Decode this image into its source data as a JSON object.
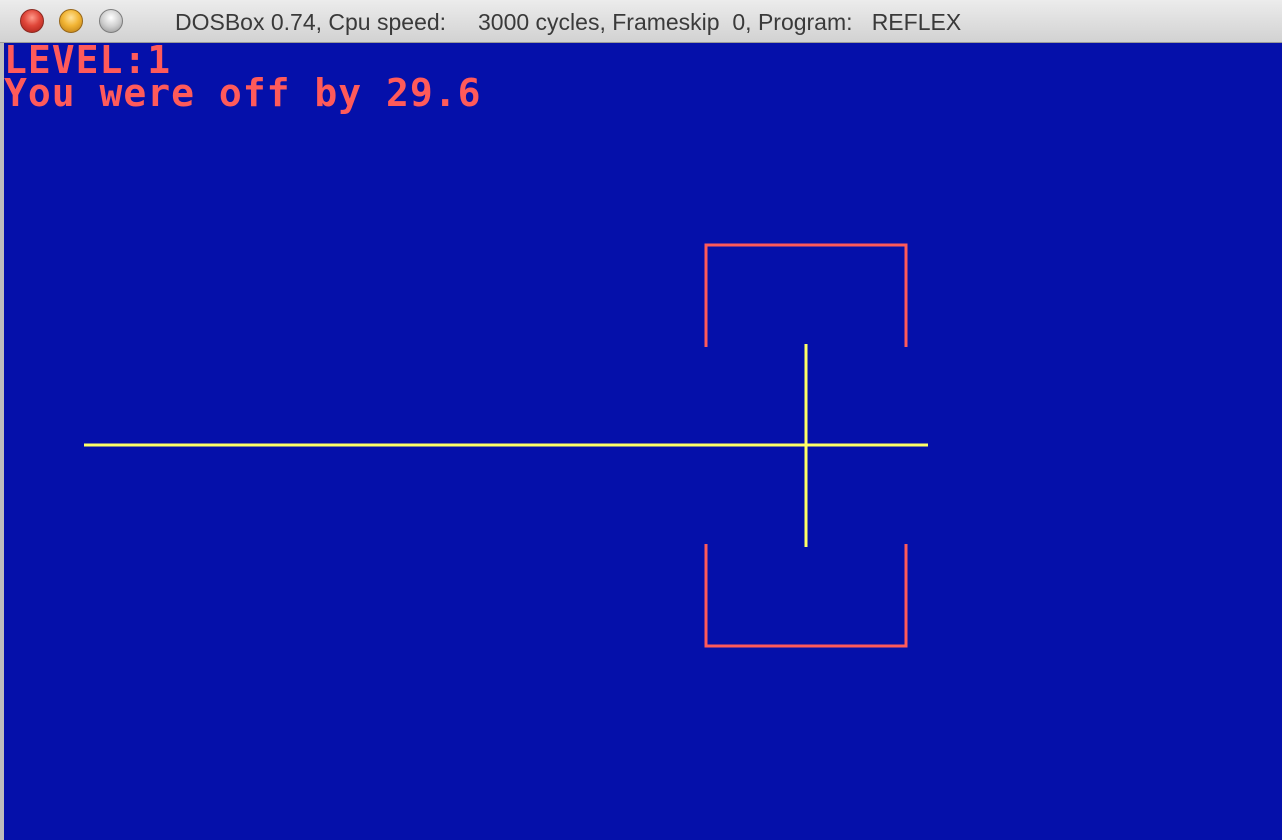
{
  "window": {
    "title": "DOSBox 0.74, Cpu speed:     3000 cycles, Frameskip  0, Program:   REFLEX",
    "buttons": {
      "close_icon": "close-icon",
      "minimize_icon": "minimize-icon",
      "zoom_icon": "zoom-icon"
    }
  },
  "game": {
    "level_text": "LEVEL:1",
    "result_text": "You were off by 29.6",
    "colors": {
      "background": "#0510aa",
      "text": "#ff5a5a",
      "target_bracket": "#ff5a5a",
      "crosshair": "#ffff66"
    }
  }
}
